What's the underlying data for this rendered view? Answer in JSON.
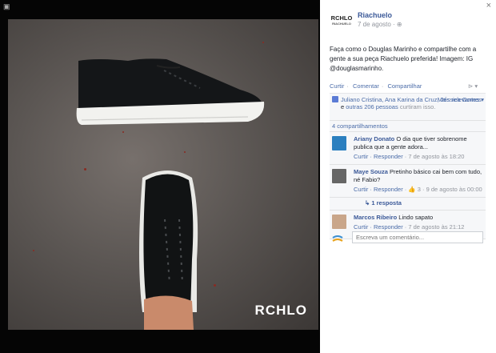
{
  "viewer": {
    "watermark": "RCHLO",
    "top_icon": "▣"
  },
  "panel": {
    "close": "×",
    "logo": {
      "text": "RCHLO",
      "sub": "RIACHUELO"
    },
    "page_name": "Riachuelo",
    "date": "7 de agosto · ⊕",
    "post_text": "Faça como o Douglas Marinho e compartilhe com a gente a sua peça Riachuelo preferida! Imagem: IG @douglasmarinho.",
    "actions": {
      "like": "Curtir",
      "comment": "Comentar",
      "share": "Compartilhar"
    },
    "share_arrow": "⊳ ▾",
    "likes": {
      "names_part1": "Juliano Cristina, Ana Karina da Cruz, Jéssica Gomes",
      "names_part2": " e ",
      "others": "outras 206 pessoas",
      "suffix": " curtiram isso.",
      "more": "Mais relevantes ▾"
    },
    "shares": "4 compartilhamentos",
    "comments": [
      {
        "author": "Ariany Donato",
        "text": " O dia que tiver sobrenome publica que a gente adora...",
        "reply": "Curtir · Responder",
        "time": " · 7 de agosto às 18:20",
        "avatar_color": "#2b7fbf"
      },
      {
        "author": "Maye Souza",
        "text": " Pretinho básico cai bem com tudo, né Fabio?",
        "reply": "Curtir · Responder",
        "time": " · 👍 3 · 9 de agosto às 00:00",
        "avatar_color": "#666666"
      },
      {
        "author": "Marcos Ribeiro",
        "text": " Lindo sapato",
        "reply": "Curtir · Responder",
        "time": " · 7 de agosto às 21:12",
        "avatar_color": "#c9a68a"
      }
    ],
    "replies_link": "↳ 1 resposta",
    "composer_placeholder": "Escreva um comentário..."
  }
}
